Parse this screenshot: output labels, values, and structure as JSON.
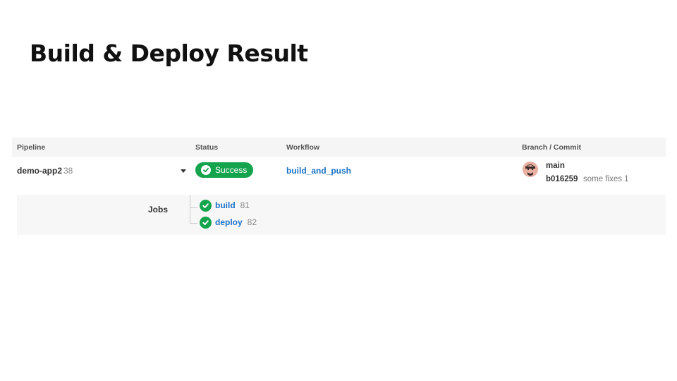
{
  "slide": {
    "title": "Build & Deploy Result"
  },
  "table": {
    "headers": {
      "pipeline": "Pipeline",
      "status": "Status",
      "workflow": "Workflow",
      "branch_commit": "Branch / Commit"
    },
    "pipeline": {
      "name": "demo-app2",
      "id": "38"
    },
    "status": {
      "label": "Success",
      "color": "#14a44d"
    },
    "workflow": {
      "name": "build_and_push"
    },
    "branch": {
      "name": "main"
    },
    "commit": {
      "hash": "b016259",
      "message": "some fixes 1"
    },
    "jobs": {
      "label": "Jobs",
      "items": [
        {
          "name": "build",
          "id": "81"
        },
        {
          "name": "deploy",
          "id": "82"
        }
      ]
    }
  }
}
